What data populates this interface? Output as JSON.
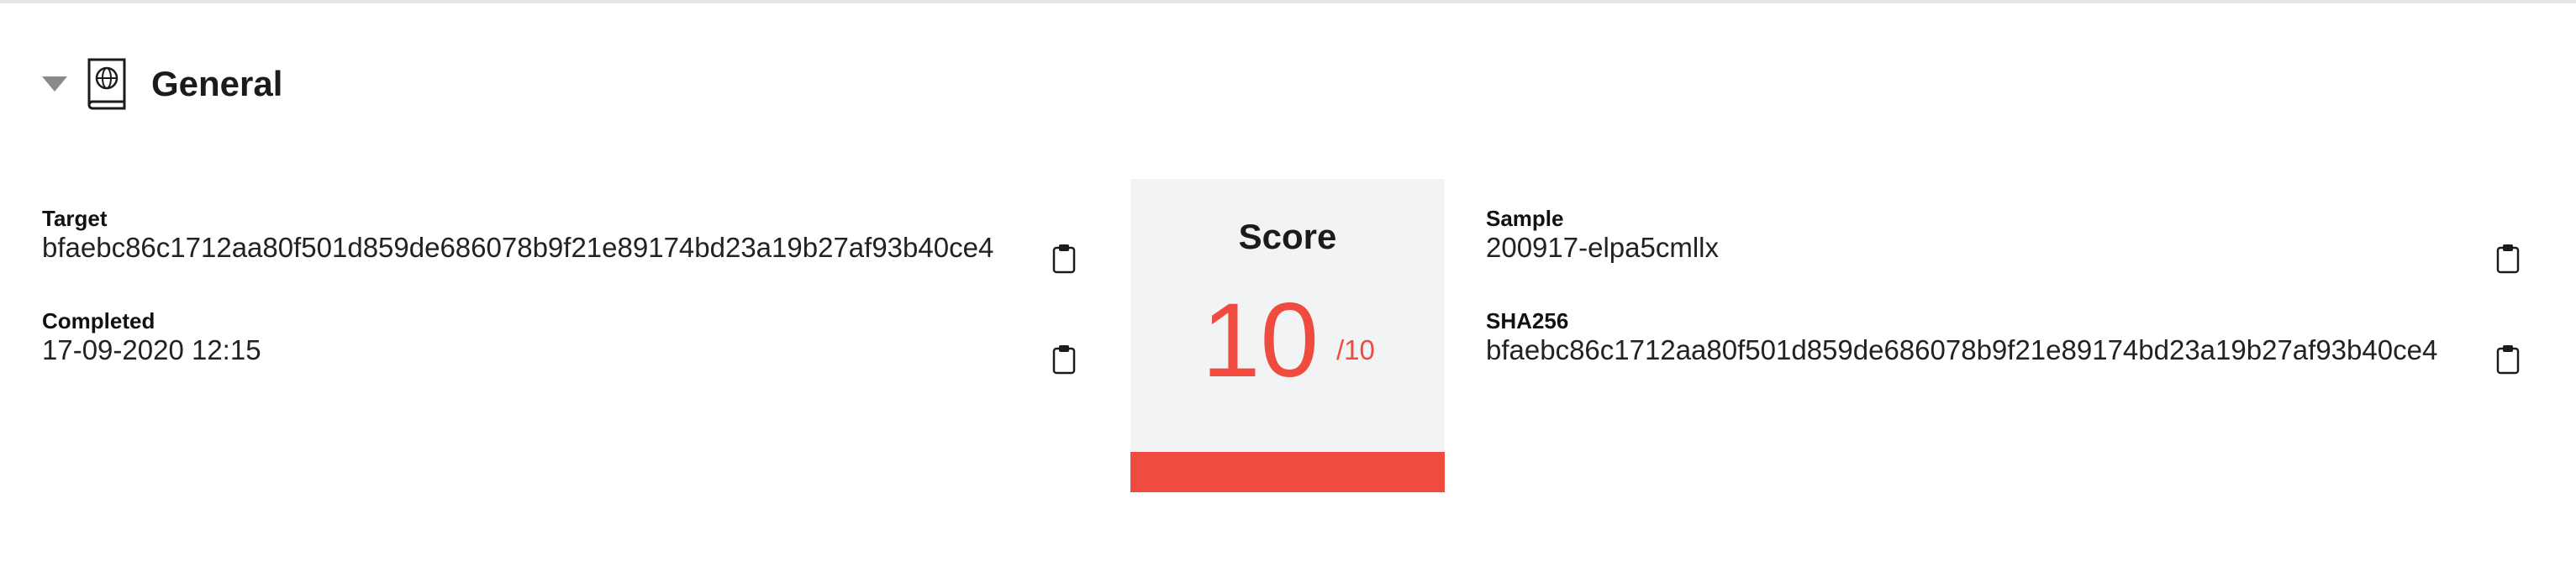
{
  "section": {
    "title": "General"
  },
  "left": {
    "target": {
      "label": "Target",
      "value": "bfaebc86c1712aa80f501d859de686078b9f21e89174bd23a19b27af93b40ce4"
    },
    "completed": {
      "label": "Completed",
      "value": "17-09-2020 12:15"
    }
  },
  "score": {
    "title": "Score",
    "value": "10",
    "max": "/10",
    "fraction": 1.0,
    "color": "#ef4b3f"
  },
  "right": {
    "sample": {
      "label": "Sample",
      "value": "200917-elpa5cmllx"
    },
    "sha256": {
      "label": "SHA256",
      "value": "bfaebc86c1712aa80f501d859de686078b9f21e89174bd23a19b27af93b40ce4"
    }
  },
  "icons": {
    "collapse": "caret-down-icon",
    "section": "book-globe-icon",
    "copy": "clipboard-icon"
  }
}
